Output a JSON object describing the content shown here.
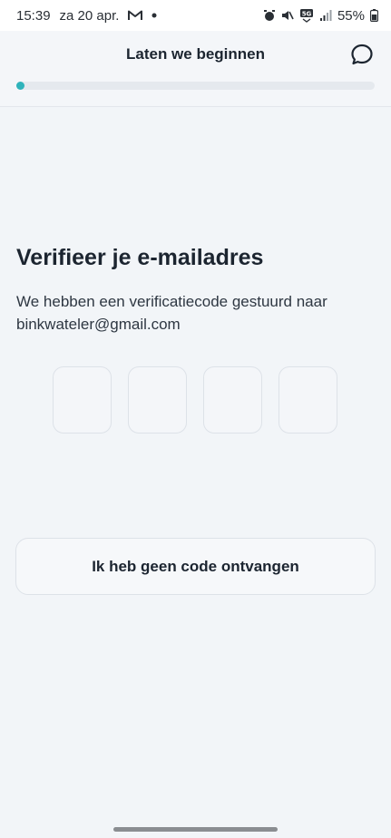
{
  "status_bar": {
    "time": "15:39",
    "date": "za 20 apr.",
    "network": "5G",
    "battery": "55%",
    "icons": [
      "gmail-icon",
      "dot-icon",
      "alarm-icon",
      "mute-icon",
      "network-5g-icon",
      "signal-icon",
      "battery-icon"
    ]
  },
  "header": {
    "title": "Laten we beginnen",
    "chat_icon": "chat-bubble-icon",
    "progress_fraction": 0.01
  },
  "main": {
    "title": "Verifieer je e-mailadres",
    "subtitle": "We hebben een verificatiecode gestuurd naar binkwateler@gmail.com",
    "code_fields": [
      {
        "value": ""
      },
      {
        "value": ""
      },
      {
        "value": ""
      },
      {
        "value": ""
      }
    ],
    "resend_button_label": "Ik heb geen code ontvangen"
  },
  "colors": {
    "accent": "#2fb3bb",
    "background": "#f2f5f8",
    "text": "#1c2530"
  }
}
